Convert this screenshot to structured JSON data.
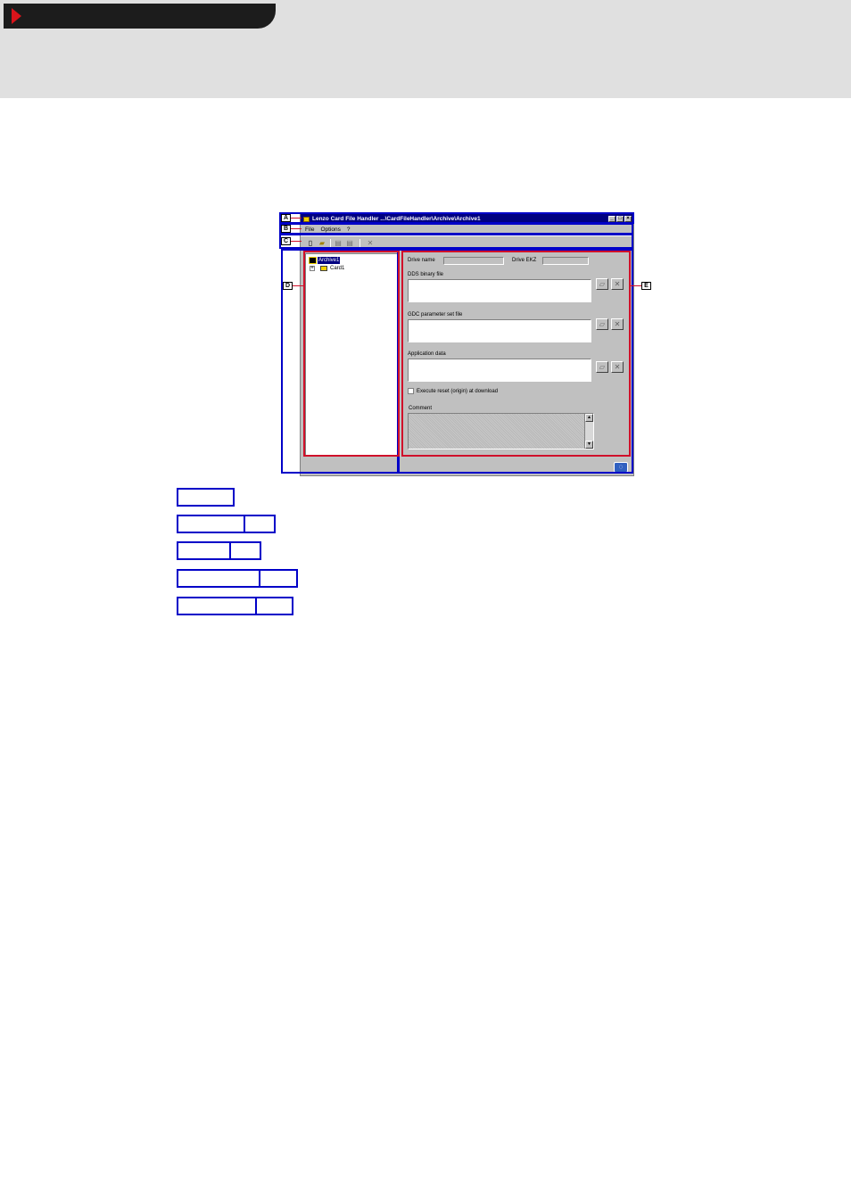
{
  "window": {
    "title": "Lenzo Card File Handler  ...\\CardFileHandler\\Archive\\Archive1",
    "title_buttons": [
      "_",
      "□",
      "×"
    ]
  },
  "menu": {
    "items": [
      "File",
      "Options",
      "?"
    ]
  },
  "toolbar": {
    "icons": [
      "new-file-icon",
      "open-folder-icon",
      "upload-card-icon",
      "download-card-icon",
      "delete-icon"
    ]
  },
  "tree": {
    "root_label": "Archive1",
    "child_label": "Card1",
    "expander": "+"
  },
  "form": {
    "drive_name_label": "Drive name",
    "drive_ekz_label": "Drive EKZ",
    "dds_label": "DDS binary file",
    "gdc_label": "GDC parameter set file",
    "app_label": "Application data",
    "reset_label": "Execute reset (origin) at download",
    "comment_label": "Comment"
  },
  "callouts": {
    "a": "A",
    "b": "B",
    "c": "C",
    "d": "D",
    "e": "E"
  },
  "colors": {
    "header_band": "#e0e0e0",
    "header_tab": "#1c1c1c",
    "arrow": "#d9141b",
    "annotation_blue": "#0000c8",
    "annotation_red": "#d0102a",
    "titlebar": "#000080"
  }
}
